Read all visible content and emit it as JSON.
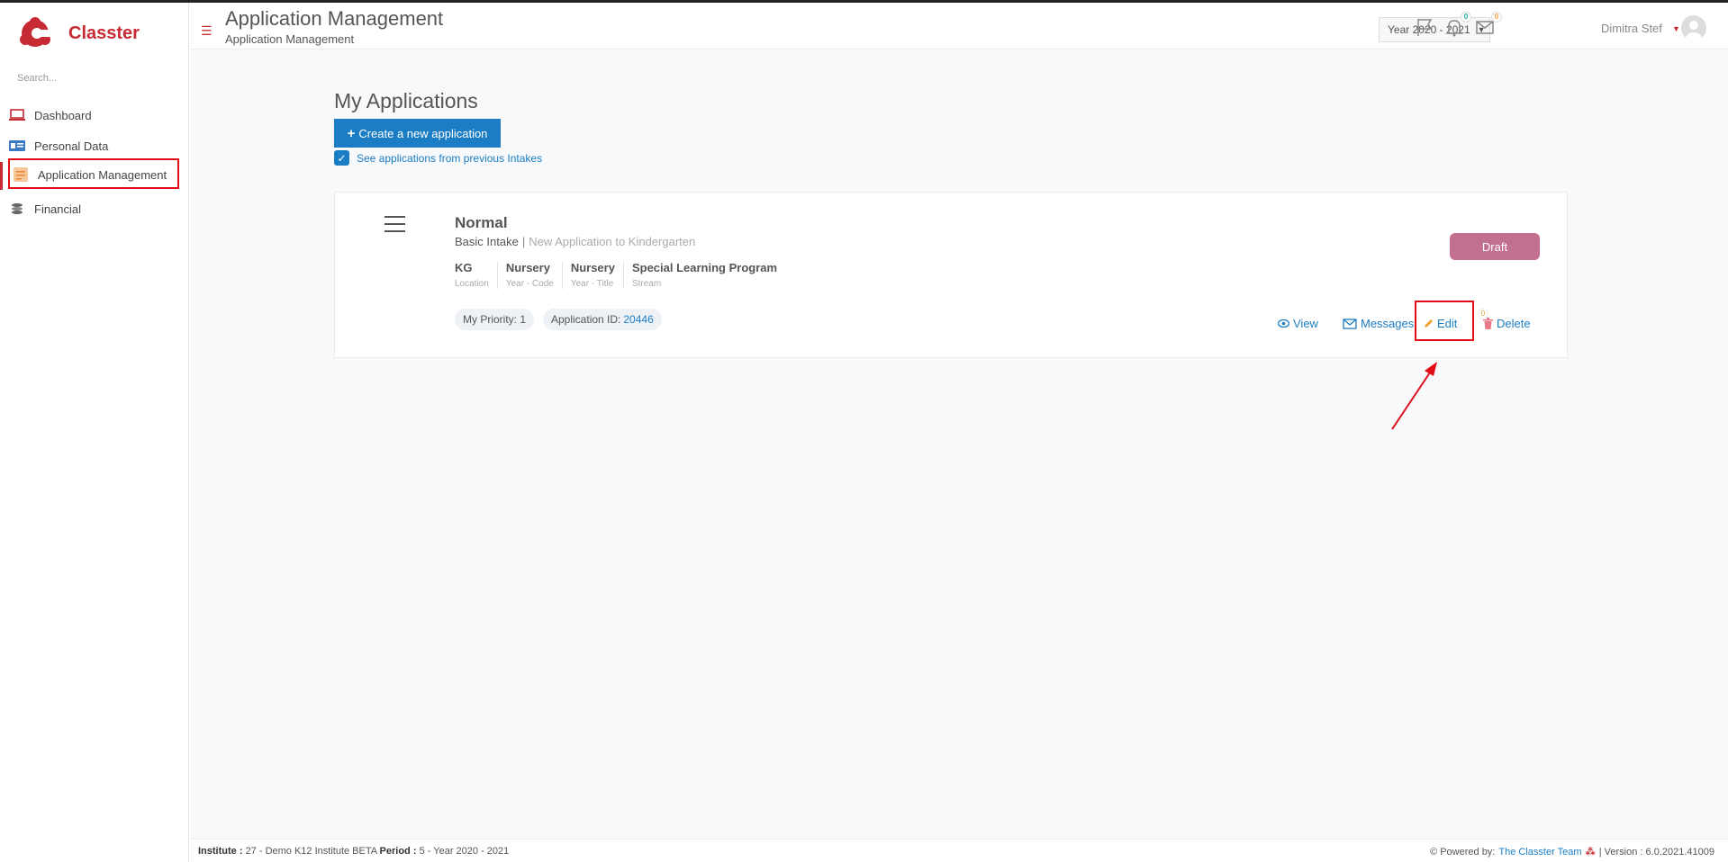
{
  "brand": {
    "name": "Classter"
  },
  "sidebar": {
    "search_placeholder": "Search...",
    "items": [
      {
        "label": "Dashboard",
        "icon": "laptop-icon"
      },
      {
        "label": "Personal Data",
        "icon": "id-card-icon"
      },
      {
        "label": "Application Management",
        "icon": "application-icon",
        "active": true
      },
      {
        "label": "Financial",
        "icon": "coins-icon"
      }
    ]
  },
  "header": {
    "title": "Application Management",
    "subtitle": "Application Management",
    "year_selector": "Year 2020 - 2021",
    "notifications_count": "0",
    "messages_count": "0",
    "user_name": "Dimitra Stef"
  },
  "main": {
    "heading": "My Applications",
    "create_button": "Create a new application",
    "previous_intakes_label": "See applications from previous Intakes",
    "application": {
      "title": "Normal",
      "intake": "Basic Intake",
      "description": "New Application to Kindergarten",
      "attributes": [
        {
          "value": "KG",
          "label": "Location"
        },
        {
          "value": "Nursery",
          "label": "Year - Code"
        },
        {
          "value": "Nursery",
          "label": "Year - Title"
        },
        {
          "value": "Special Learning Program",
          "label": "Stream"
        }
      ],
      "priority_label": "My Priority: 1",
      "app_id_label": "Application ID:",
      "app_id": "20446",
      "status": "Draft",
      "actions": {
        "view": "View",
        "messages": "Messages",
        "messages_count": "0",
        "edit": "Edit",
        "delete": "Delete"
      }
    }
  },
  "footer": {
    "institute_label": "Institute :",
    "institute_value": "27 - Demo K12 Institute BETA",
    "period_label": "Period :",
    "period_value": "5 - Year 2020 - 2021",
    "powered_by": "Powered by:",
    "team_link": "The Classter Team",
    "version": "| Version : 6.0.2021.41009"
  },
  "colors": {
    "brand_red": "#c62b34",
    "link_blue": "#1b7dc4",
    "draft_pink": "#c17090",
    "highlight_red": "#e20d17"
  }
}
